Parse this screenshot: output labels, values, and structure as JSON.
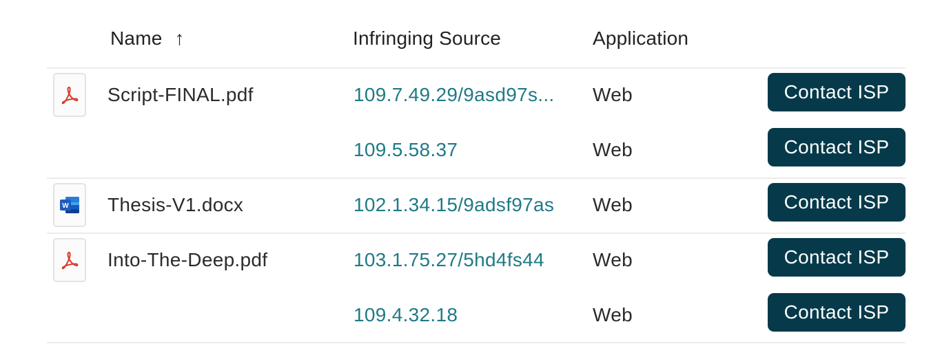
{
  "table": {
    "columns": {
      "name": "Name",
      "sort_icon": "arrow-up-icon",
      "sort_glyph": "↑",
      "source": "Infringing Source",
      "application": "Application"
    },
    "rows": [
      {
        "file_name": "Script-FINAL.pdf",
        "file_icon": "pdf-icon",
        "source": "109.7.49.29/9asd97s...",
        "application": "Web",
        "action": "Contact ISP"
      },
      {
        "file_name": "",
        "file_icon": "",
        "source": "109.5.58.37",
        "application": "Web",
        "action": "Contact ISP"
      },
      {
        "file_name": "Thesis-V1.docx",
        "file_icon": "word-icon",
        "source": "102.1.34.15/9adsf97as",
        "application": "Web",
        "action": "Contact ISP"
      },
      {
        "file_name": "Into-The-Deep.pdf",
        "file_icon": "pdf-icon",
        "source": "103.1.75.27/5hd4fs44",
        "application": "Web",
        "action": "Contact ISP"
      },
      {
        "file_name": "",
        "file_icon": "",
        "source": "109.4.32.18",
        "application": "Web",
        "action": "Contact ISP"
      }
    ]
  },
  "colors": {
    "link": "#1f7a86",
    "button_bg": "#063a4b",
    "button_text": "#ffffff",
    "pdf_red": "#d93a2b",
    "word_blue": "#1f5bc1",
    "divider": "#ececec"
  }
}
